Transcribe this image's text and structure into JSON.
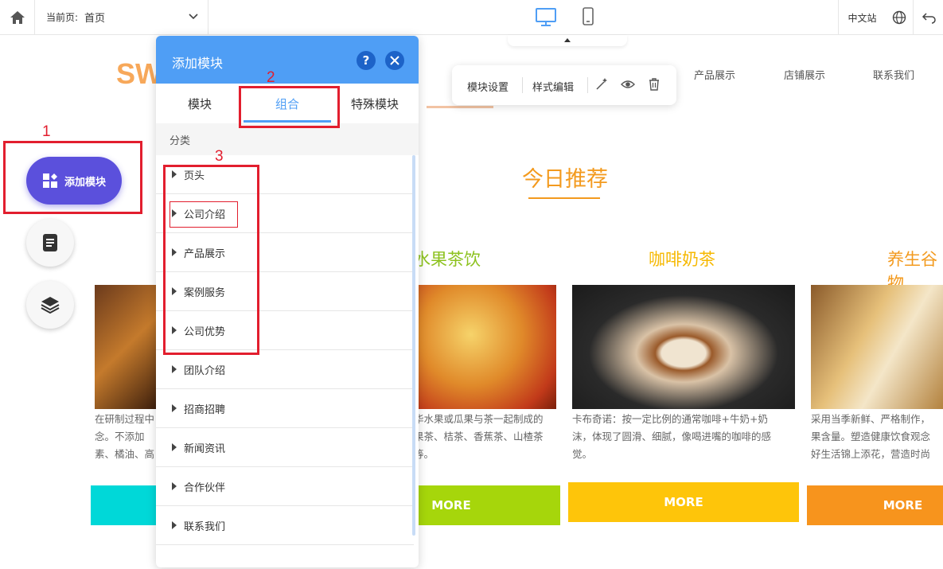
{
  "topbar": {
    "current_page_label": "当前页:",
    "current_page_value": "首页",
    "language": "中文站"
  },
  "site": {
    "logo": "SW",
    "nav": [
      "产品展示",
      "店铺展示",
      "联系我们"
    ],
    "section_title": "今日推荐",
    "columns": [
      {
        "title": "水果茶饮",
        "title_color": "#8dc21f",
        "desc": [
          "华水果或瓜果与茶一起制成的",
          "果茶、桔茶、香蕉茶、山楂茶",
          "等。"
        ],
        "more": "MORE",
        "more_color": "#a6d60b"
      },
      {
        "title": "咖啡奶茶",
        "title_color": "#f6b800",
        "desc": [
          "卡布奇诺：按一定比例的通常咖啡+牛奶+奶",
          "沫，体现了圆滑、细腻，像喝进嘴的咖啡的感",
          "觉。"
        ],
        "more": "MORE",
        "more_color": "#fec50a"
      },
      {
        "title": "养生谷物",
        "title_color": "#f39a1e",
        "desc": [
          "采用当季新鲜、严格制作，",
          "果含量。塑造健康饮食观念",
          "好生活锦上添花，营造时尚"
        ],
        "more": "MORE",
        "more_color": "#f7941d"
      }
    ],
    "first_column_desc": [
      "在研制过程中",
      "念。不添加",
      "素、橘油、高"
    ],
    "first_more_color": "#00d8d8"
  },
  "toolbar": {
    "module_settings": "模块设置",
    "style_edit": "样式编辑"
  },
  "left_fab": {
    "add_module": "添加模块"
  },
  "panel": {
    "title": "添加模块",
    "help": "?",
    "tabs": [
      "模块",
      "组合",
      "特殊模块"
    ],
    "active_tab": "组合",
    "category_header": "分类",
    "categories": [
      "页头",
      "公司介绍",
      "产品展示",
      "案例服务",
      "公司优势",
      "团队介绍",
      "招商招聘",
      "新闻资讯",
      "合作伙伴",
      "联系我们"
    ]
  },
  "annotations": {
    "step1": "1",
    "step2": "2",
    "step3": "3"
  },
  "colors": {
    "panel_header": "#4f9ef5",
    "fab": "#5b50dc",
    "annotation_red": "#e21e2e"
  }
}
